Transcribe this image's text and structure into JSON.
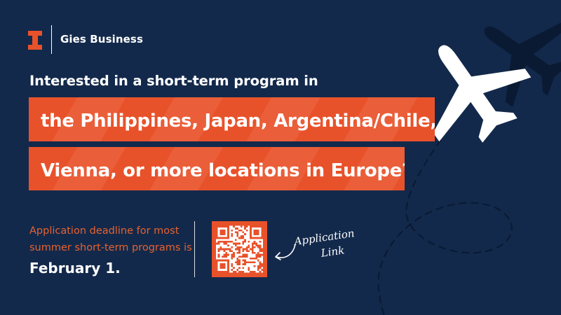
{
  "brand": {
    "name": "Gies Business",
    "logo_icon": "block-i-logo-icon",
    "colors": {
      "background": "#13294b",
      "accent": "#e8522a",
      "deadline_text": "#e8612f"
    }
  },
  "headline": "Interested in a short-term program in",
  "banners": [
    "the Philippines, Japan, Argentina/Chile,",
    "Vienna, or more locations in Europe?"
  ],
  "deadline": {
    "line1": "Application deadline for most",
    "line2": "summer short-term programs is",
    "date": "February 1."
  },
  "application_link": {
    "line1": "Application",
    "line2": "Link",
    "qr_icon": "qr-code-icon",
    "arrow_icon": "curved-arrow-icon"
  },
  "decorations": {
    "plane_icon": "airplane-icon",
    "path_icon": "dashed-flight-path-icon"
  }
}
